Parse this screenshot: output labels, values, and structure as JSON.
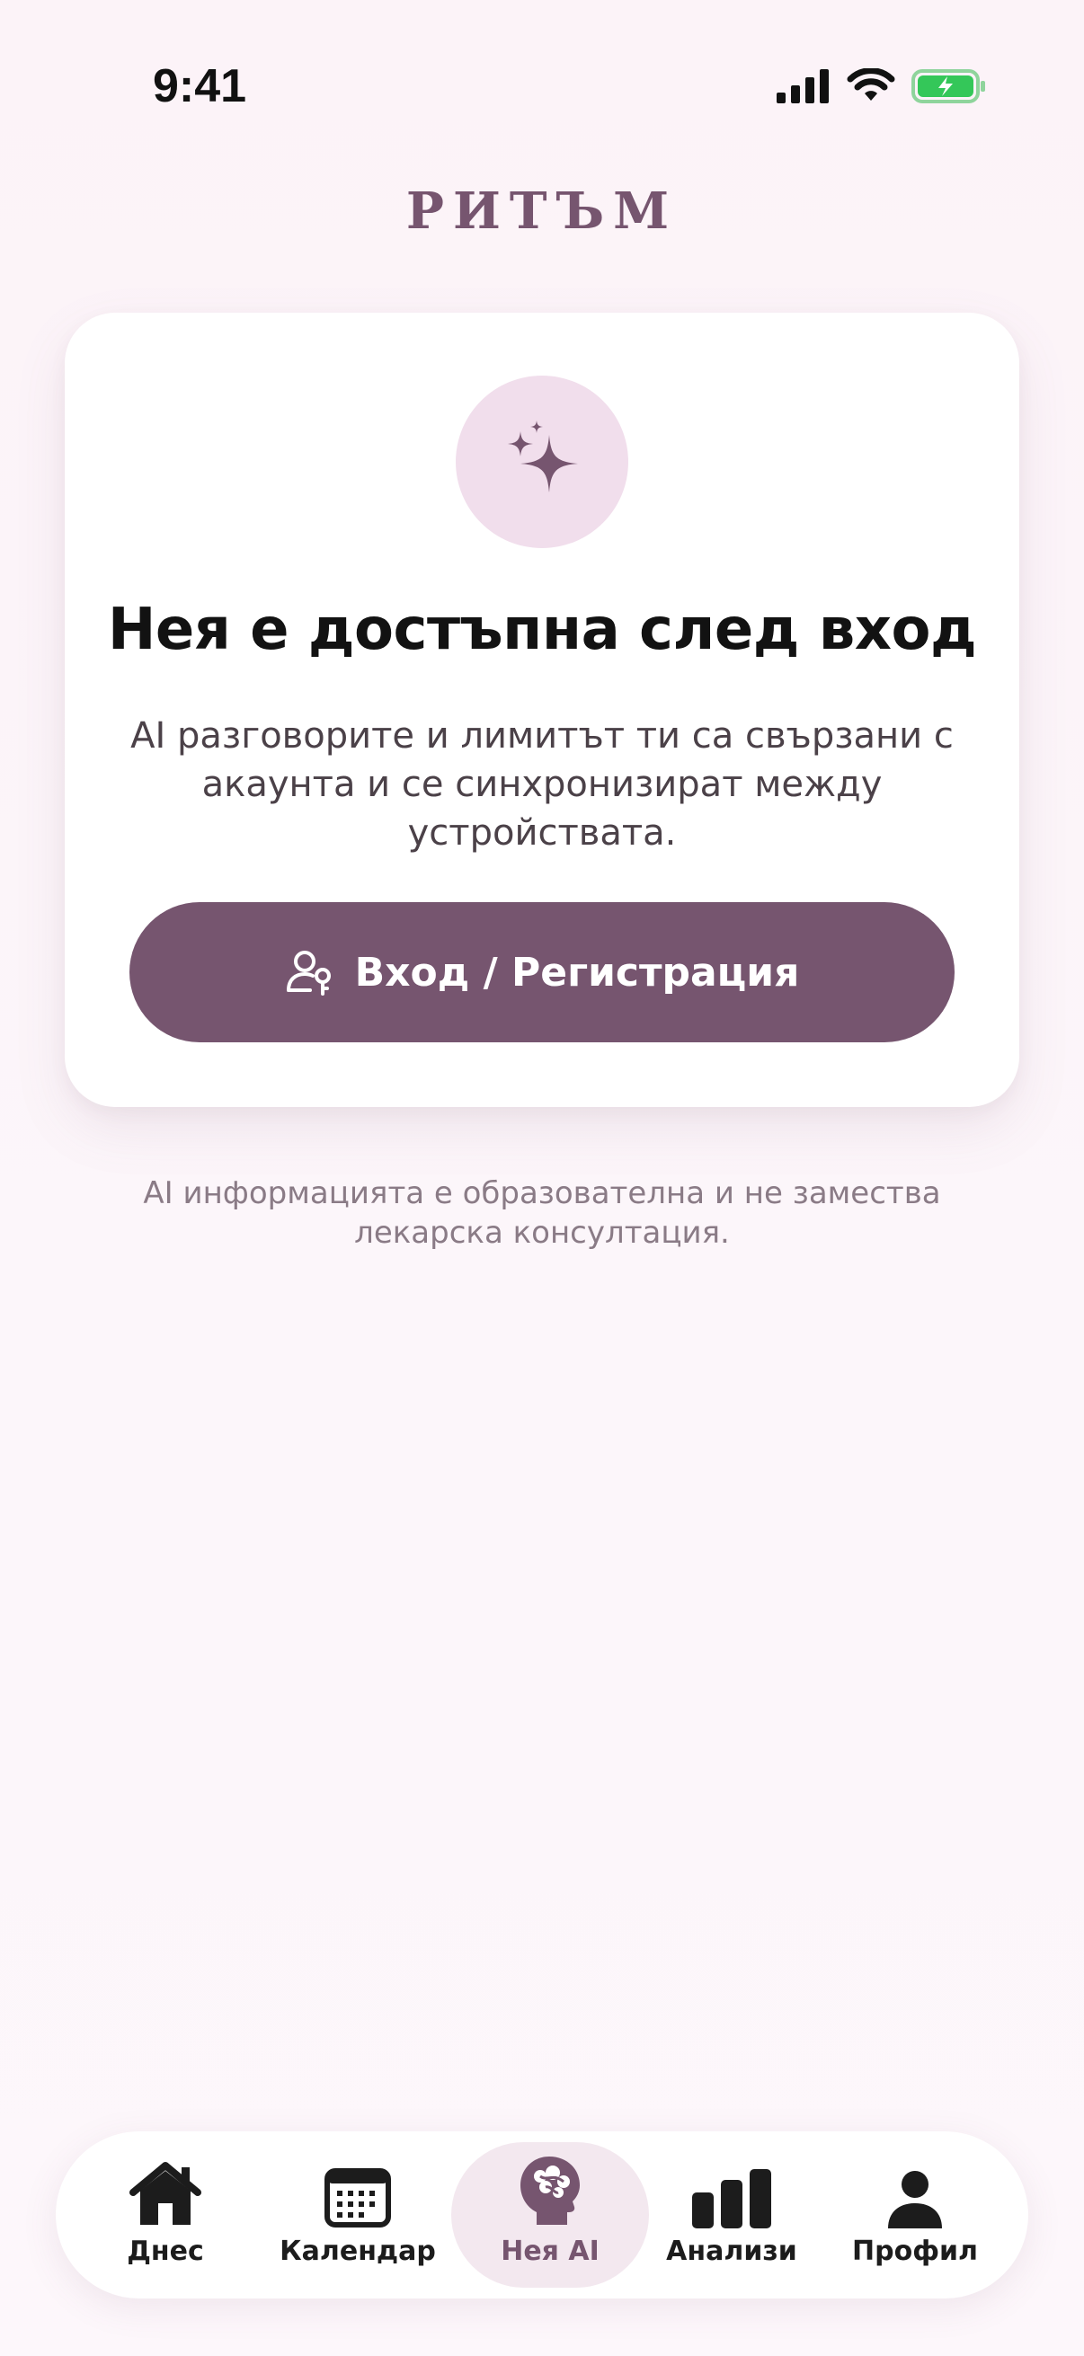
{
  "status_bar": {
    "time": "9:41"
  },
  "brand": {
    "name": "РИТЪМ"
  },
  "card": {
    "icon": "sparkles-icon",
    "title": "Нея е достъпна след вход",
    "description": "AI разговорите и лимитът ти са свързани с акаунта и се синхронизират между устройствата.",
    "button_label": "Вход / Регистрация",
    "button_icon": "user-key-icon"
  },
  "disclaimer": "AI информацията е образователна и не замества лекарска консултация.",
  "nav": {
    "items": [
      {
        "label": "Днес",
        "icon": "home-icon"
      },
      {
        "label": "Календар",
        "icon": "calendar-icon"
      },
      {
        "label": "Нея AI",
        "icon": "ai-head-icon"
      },
      {
        "label": "Анализи",
        "icon": "bar-chart-icon"
      },
      {
        "label": "Профил",
        "icon": "person-icon"
      }
    ]
  },
  "colors": {
    "accent": "#76556f",
    "accent_soft": "#f1deec",
    "background": "#fcf5f9",
    "battery": "#34c759"
  }
}
